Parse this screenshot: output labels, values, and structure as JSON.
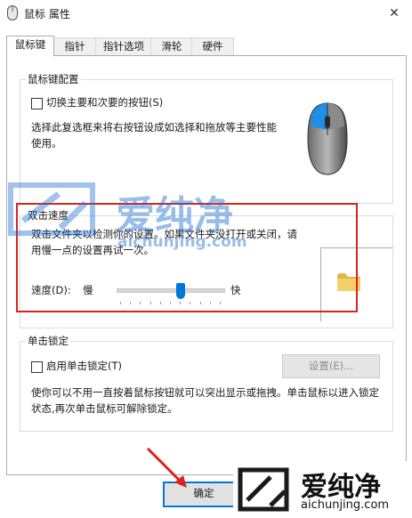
{
  "window": {
    "title": "鼠标 属性",
    "close_glyph": "✕"
  },
  "tabs": [
    {
      "label": "鼠标键"
    },
    {
      "label": "指针"
    },
    {
      "label": "指针选项"
    },
    {
      "label": "滑轮"
    },
    {
      "label": "硬件"
    }
  ],
  "button_config": {
    "group_label": "鼠标键配置",
    "switch_checkbox_label": "切换主要和次要的按钮(S)",
    "switch_checked": false,
    "description": "选择此复选框来将右按钮设成如选择和拖放等主要性能使用。"
  },
  "double_click": {
    "group_label": "双击速度",
    "description": "双击文件夹以检测你的设置。如果文件夹没打开或关闭，请用慢一点的设置再试一次。",
    "speed_label": "速度(D):",
    "slow_label": "慢",
    "fast_label": "快",
    "speed_level": 0.6
  },
  "click_lock": {
    "group_label": "单击锁定",
    "enable_label": "启用单击锁定(T)",
    "enabled": false,
    "settings_button": "设置(E)...",
    "description": "使你可以不用一直按着鼠标按钮就可以突出显示或拖拽。单击鼠标以进入锁定状态,再次单击鼠标可解除锁定。"
  },
  "footer": {
    "ok_button": "确定"
  },
  "watermark": {
    "brand": "爱纯净",
    "url": "aichunjing.com"
  },
  "colors": {
    "accent": "#0078d7",
    "highlight_box": "#d9251d",
    "arrow": "#e02020",
    "watermark_blue": "#1f6fd1"
  },
  "icons": [
    "mouse-icon",
    "mouse-illustration",
    "folder-icon",
    "close-icon",
    "arrow-annotation"
  ]
}
